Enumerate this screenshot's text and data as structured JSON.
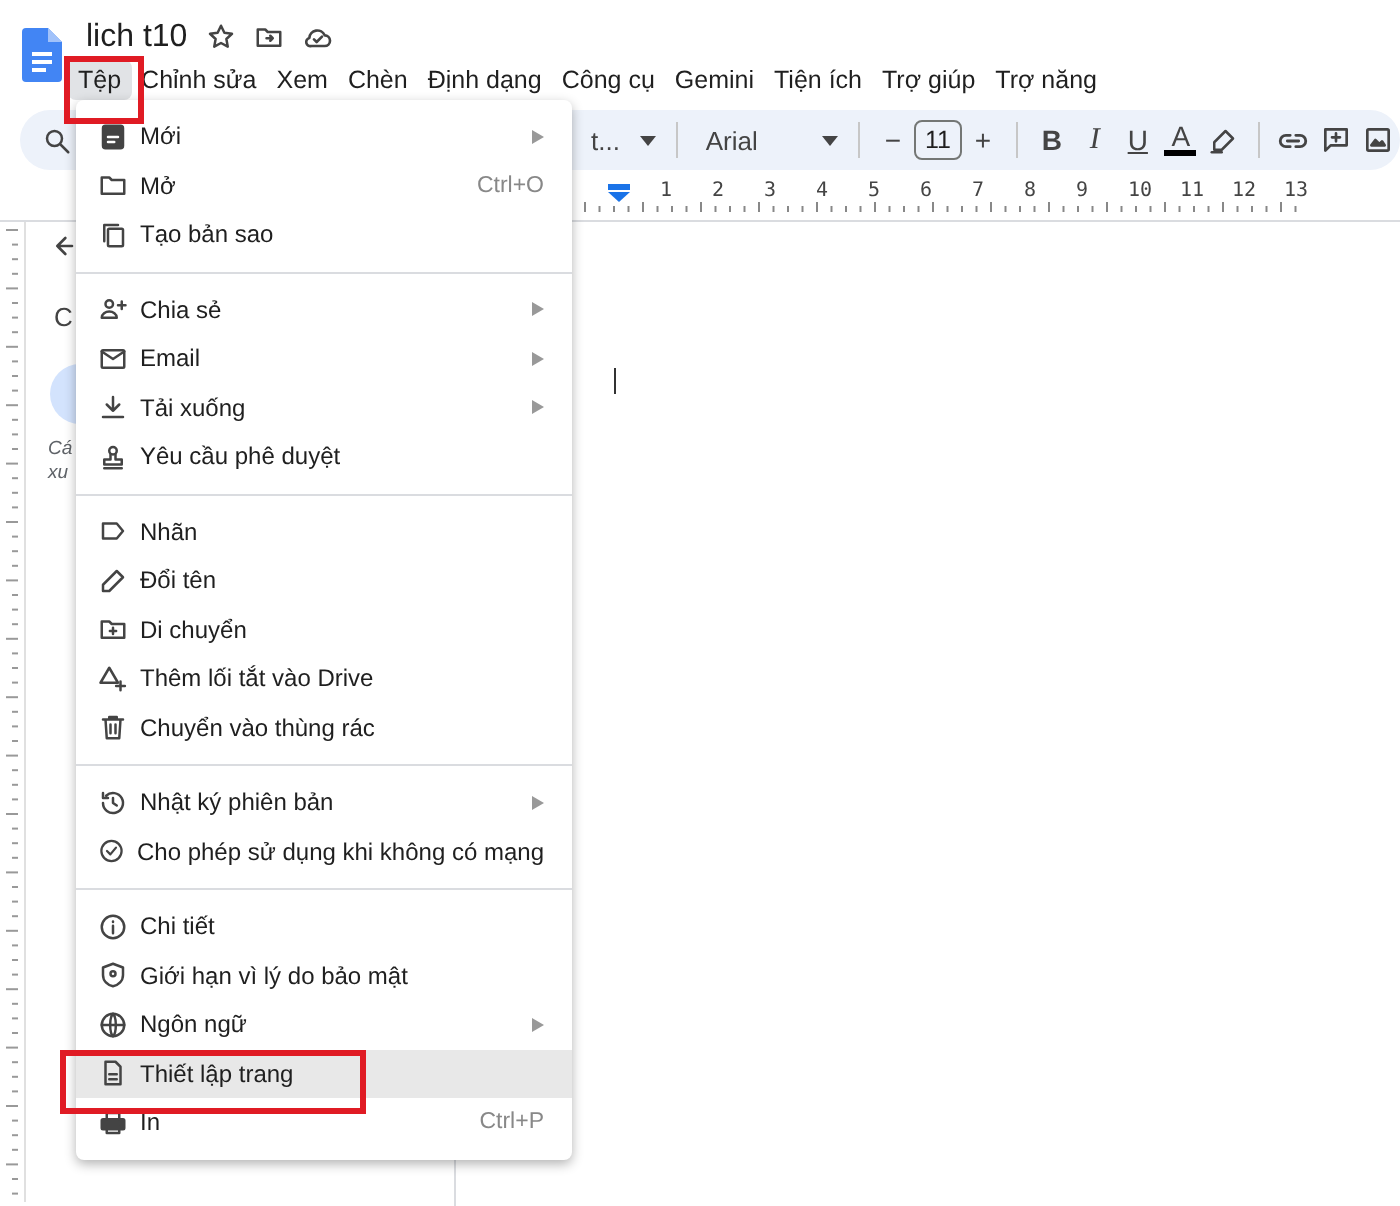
{
  "document": {
    "title": "lich t10"
  },
  "menubar": [
    {
      "label": "Tệp",
      "selected": true,
      "annotated": true
    },
    {
      "label": "Chỉnh sửa",
      "selected": false,
      "annotated": false
    },
    {
      "label": "Xem",
      "selected": false,
      "annotated": false
    },
    {
      "label": "Chèn",
      "selected": false,
      "annotated": false
    },
    {
      "label": "Định dạng",
      "selected": false,
      "annotated": false
    },
    {
      "label": "Công cụ",
      "selected": false,
      "annotated": false
    },
    {
      "label": "Gemini",
      "selected": false,
      "annotated": false
    },
    {
      "label": "Tiện ích",
      "selected": false,
      "annotated": false
    },
    {
      "label": "Trợ giúp",
      "selected": false,
      "annotated": false
    },
    {
      "label": "Trợ năng",
      "selected": false,
      "annotated": false
    }
  ],
  "toolbar": {
    "style_value": "t...",
    "font": "Arial",
    "decrease": "−",
    "font_size": "11",
    "increase": "+",
    "bold": "B",
    "italic": "I",
    "underline": "U",
    "text_color": "A"
  },
  "ruler": {
    "marks": [
      "1",
      "2",
      "3",
      "4",
      "5",
      "6",
      "7",
      "8",
      "9",
      "10",
      "11",
      "12",
      "13"
    ]
  },
  "outline": {
    "heading": "C",
    "note_lines": [
      "Cá",
      "xu"
    ]
  },
  "file_menu": {
    "groups": [
      {
        "items": [
          {
            "label": "Mới",
            "submenu": true,
            "highlighted": false,
            "annotated": false
          },
          {
            "label": "Mở",
            "shortcut": "Ctrl+O",
            "submenu": false,
            "highlighted": false,
            "annotated": false
          },
          {
            "label": "Tạo bản sao",
            "submenu": false,
            "highlighted": false,
            "annotated": false
          }
        ]
      },
      {
        "items": [
          {
            "label": "Chia sẻ",
            "submenu": true,
            "highlighted": false,
            "annotated": false
          },
          {
            "label": "Email",
            "submenu": true,
            "highlighted": false,
            "annotated": false
          },
          {
            "label": "Tải xuống",
            "submenu": true,
            "highlighted": false,
            "annotated": false
          },
          {
            "label": "Yêu cầu phê duyệt",
            "submenu": false,
            "highlighted": false,
            "annotated": false
          }
        ]
      },
      {
        "items": [
          {
            "label": "Nhãn",
            "submenu": false,
            "highlighted": false,
            "annotated": false
          },
          {
            "label": "Đổi tên",
            "submenu": false,
            "highlighted": false,
            "annotated": false
          },
          {
            "label": "Di chuyển",
            "submenu": false,
            "highlighted": false,
            "annotated": false
          },
          {
            "label": "Thêm lối tắt vào Drive",
            "submenu": false,
            "highlighted": false,
            "annotated": false
          },
          {
            "label": "Chuyển vào thùng rác",
            "submenu": false,
            "highlighted": false,
            "annotated": false
          }
        ]
      },
      {
        "items": [
          {
            "label": "Nhật ký phiên bản",
            "submenu": true,
            "highlighted": false,
            "annotated": false
          },
          {
            "label": "Cho phép sử dụng khi không có mạng",
            "submenu": false,
            "highlighted": false,
            "annotated": false
          }
        ]
      },
      {
        "items": [
          {
            "label": "Chi tiết",
            "submenu": false,
            "highlighted": false,
            "annotated": false
          },
          {
            "label": "Giới hạn vì lý do bảo mật",
            "submenu": false,
            "highlighted": false,
            "annotated": false
          },
          {
            "label": "Ngôn ngữ",
            "submenu": true,
            "highlighted": false,
            "annotated": false
          },
          {
            "label": "Thiết lập trang",
            "submenu": false,
            "highlighted": true,
            "annotated": true
          },
          {
            "label": "In",
            "shortcut": "Ctrl+P",
            "submenu": false,
            "highlighted": false,
            "annotated": false
          }
        ]
      }
    ]
  }
}
